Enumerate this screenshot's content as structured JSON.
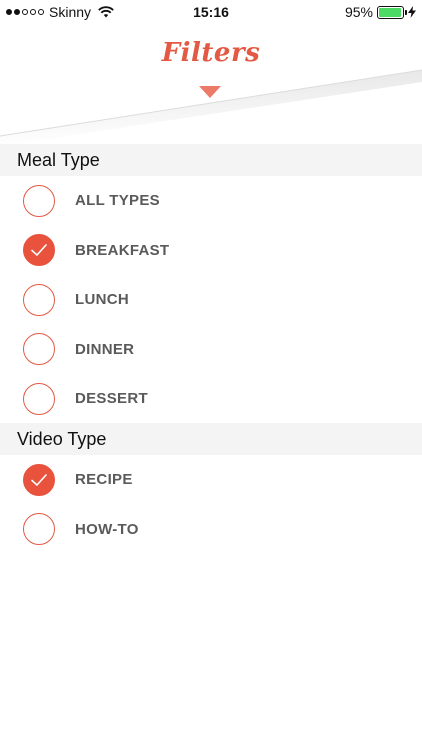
{
  "status_bar": {
    "carrier": "Skinny",
    "time": "15:16",
    "battery_percent": "95%",
    "battery_level": 0.95,
    "signal_bars_filled": 2,
    "signal_bars_total": 5
  },
  "header": {
    "title": "Filters"
  },
  "colors": {
    "accent": "#e9523d",
    "title": "#e35a44",
    "section_bg": "#f4f4f4",
    "label": "#5a5a5a",
    "battery": "#4cd964"
  },
  "meal_type": {
    "label": "Meal Type",
    "options": [
      {
        "label": "ALL TYPES",
        "checked": false
      },
      {
        "label": "BREAKFAST",
        "checked": true
      },
      {
        "label": "LUNCH",
        "checked": false
      },
      {
        "label": "DINNER",
        "checked": false
      },
      {
        "label": "DESSERT",
        "checked": false
      }
    ]
  },
  "video_type": {
    "label": "Video Type",
    "options": [
      {
        "label": "RECIPE",
        "checked": true
      },
      {
        "label": "HOW-TO",
        "checked": false
      }
    ]
  }
}
